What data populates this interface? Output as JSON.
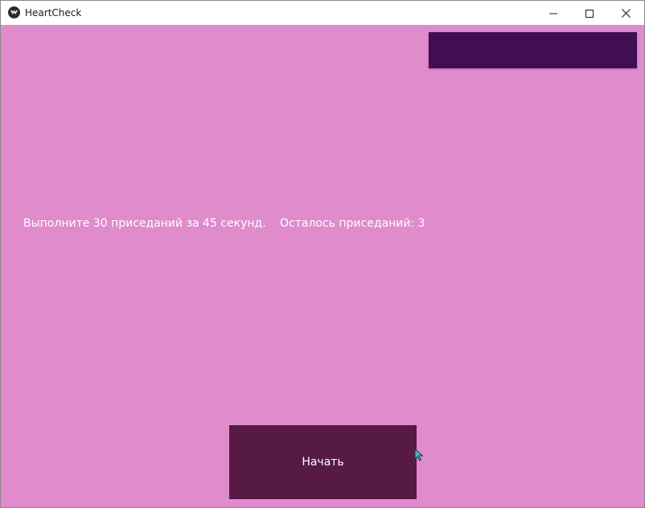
{
  "window": {
    "title": "HeartCheck",
    "controls": {
      "minimize": "minimize-icon",
      "maximize": "maximize-icon",
      "close": "close-icon"
    }
  },
  "main": {
    "instruction": "Выполните 30 приседаний за 45 секунд.",
    "remaining": "Осталось приседаний: 3",
    "start_button": "Начать"
  },
  "colors": {
    "background": "#df8bcc",
    "top_box": "#410e54",
    "button": "#561a45",
    "text": "#ffffff"
  }
}
